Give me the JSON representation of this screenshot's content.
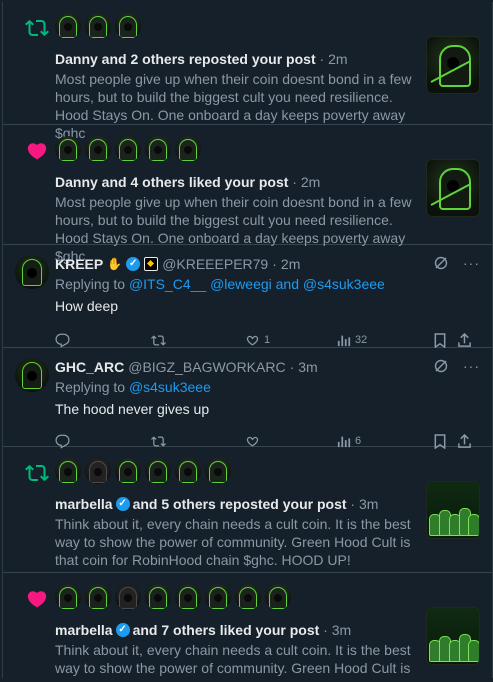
{
  "notifications": [
    {
      "type": "repost",
      "icon": "repost-icon",
      "avatar_count": 3,
      "actor": "Danny",
      "action": " and 2 others reposted your post",
      "time": " · 2m",
      "body": "Most people give up when their coin doesnt bond in a few hours, but to build the biggest cult you need resilience. Hood Stays On. One onboard a day keeps poverty away $ghc",
      "thumb_style": "hood"
    },
    {
      "type": "like",
      "icon": "heart-icon",
      "avatar_count": 5,
      "actor": "Danny",
      "action": " and 4 others liked your post",
      "time": " · 2m",
      "body": "Most people give up when their coin doesnt bond in a few hours, but to build the biggest cult you need resilience. Hood Stays On. One onboard a day keeps poverty away $ghc",
      "thumb_style": "hood"
    }
  ],
  "tweets": [
    {
      "name": "KREEP",
      "handle": "@KREEEPER79",
      "time": "2m",
      "replying_prefix": "Replying to ",
      "replying_to": "@ITS_C4__ @leweegi and @s4suk3eee",
      "text": "How deep",
      "likes": "1",
      "views": "32"
    },
    {
      "name": "GHC_ARC",
      "handle": "@BIGZ_BAGWORKARC",
      "time": "3m",
      "replying_prefix": "Replying to ",
      "replying_to": "@s4suk3eee",
      "text": "The hood never gives up",
      "likes": "",
      "views": "6"
    }
  ],
  "notifications2": [
    {
      "type": "repost",
      "icon": "repost-icon",
      "actor": "marbella",
      "action": " and 5 others reposted your post",
      "time": " · 3m",
      "body": "Think about it, every chain needs a cult coin. It is the best way to show the power of community. Green Hood Cult is that coin for RobinHood chain $ghc. HOOD UP!"
    },
    {
      "type": "like",
      "icon": "heart-icon",
      "actor": "marbella",
      "action": " and 7 others liked your post",
      "time": " · 3m",
      "body": "Think about it, every chain needs a cult coin. It is the best way to show the power of community. Green Hood Cult is that coin for RobinHood chain $ghc. HOOD UP!"
    }
  ],
  "colors": {
    "background": "#15202b",
    "repost_green": "#00ba7c",
    "like_pink": "#f91880",
    "link_blue": "#1d9bf0",
    "muted": "#8b98a5",
    "hood_green": "#5ed33a"
  }
}
